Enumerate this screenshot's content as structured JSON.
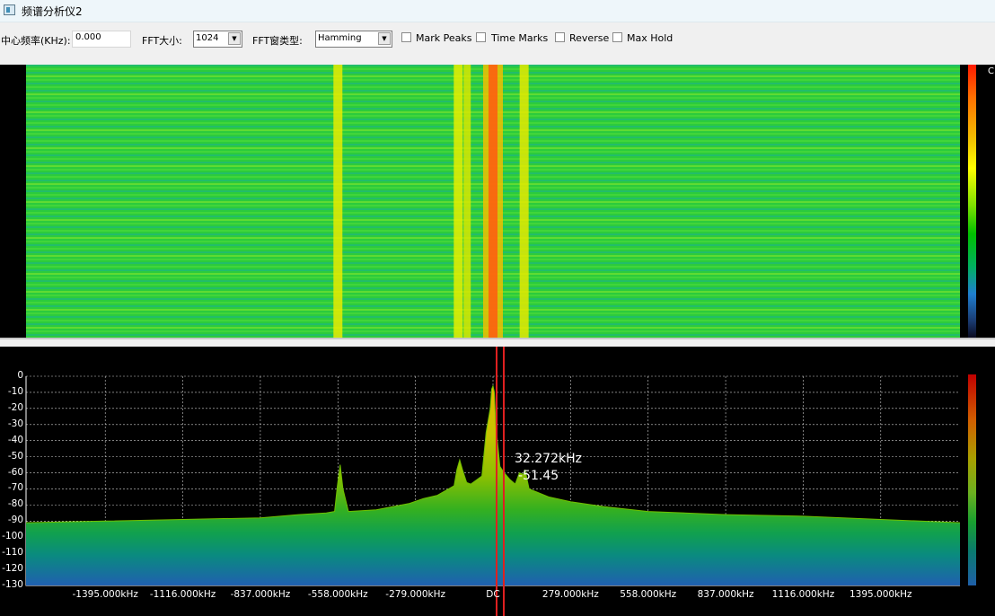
{
  "window": {
    "title": "频谱分析仪2"
  },
  "toolbar": {
    "center_freq_label": "中心频率(KHz):",
    "center_freq_value": "0.000",
    "fft_size_label": "FFT大小:",
    "fft_size_value": "1024",
    "window_type_label": "FFT窗类型:",
    "window_type_value": "Hamming",
    "checkboxes": [
      {
        "label": "Mark Peaks",
        "checked": false
      },
      {
        "label": "Time Marks",
        "checked": false
      },
      {
        "label": "Reverse",
        "checked": false
      },
      {
        "label": "Max Hold",
        "checked": false
      }
    ]
  },
  "waterfall": {
    "colorscale_top_label": "C",
    "signal_columns_khz": [
      -558,
      -125,
      -93,
      0,
      112
    ]
  },
  "spectrum": {
    "y_ticks": [
      "0",
      "-10",
      "-20",
      "-30",
      "-40",
      "-50",
      "-60",
      "-70",
      "-80",
      "-90",
      "-100",
      "-110",
      "-120",
      "-130"
    ],
    "x_ticks": [
      "-1395.000kHz",
      "-1116.000kHz",
      "-837.000kHz",
      "-558.000kHz",
      "-279.000kHz",
      "DC",
      "279.000kHz",
      "558.000kHz",
      "837.000kHz",
      "1116.000kHz",
      "1395.000kHz"
    ],
    "marker": {
      "freq_label": "32.272kHz",
      "level_label": "-51.45",
      "freq_khz": 32.272,
      "level_db": -51.45
    },
    "colors": {
      "trace": "#6fc000",
      "grid": "#cfcfcf",
      "marker_line": "#e02020"
    }
  },
  "chart_data": {
    "type": "area",
    "xlabel": "",
    "ylabel": "",
    "ylim": [
      -130,
      0
    ],
    "xlim_khz": [
      -1680,
      1680
    ],
    "x": [
      -1680,
      -1395,
      -1116,
      -837,
      -700,
      -600,
      -570,
      -560,
      -550,
      -540,
      -520,
      -420,
      -300,
      -250,
      -200,
      -140,
      -130,
      -120,
      -110,
      -95,
      -80,
      -40,
      -25,
      -10,
      -5,
      0,
      5,
      10,
      25,
      40,
      60,
      80,
      95,
      110,
      115,
      130,
      200,
      279,
      400,
      558,
      837,
      1116,
      1395,
      1680
    ],
    "values": [
      -91,
      -90,
      -89,
      -88,
      -86,
      -85,
      -84,
      -68,
      -55,
      -70,
      -84,
      -83,
      -79,
      -76,
      -74,
      -68,
      -58,
      -52,
      -58,
      -66,
      -67,
      -62,
      -35,
      -20,
      -8,
      -6,
      -10,
      -30,
      -56,
      -60,
      -64,
      -67,
      -60,
      -61,
      -58,
      -70,
      -75,
      -78,
      -81,
      -84,
      -86,
      -87,
      -89,
      -91
    ]
  }
}
